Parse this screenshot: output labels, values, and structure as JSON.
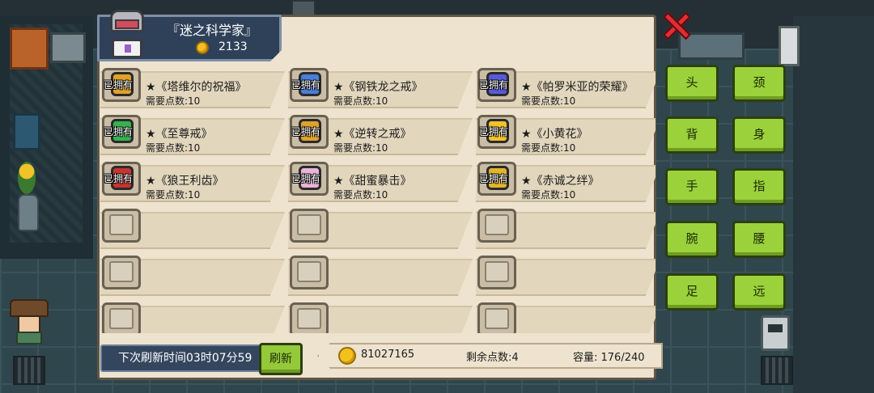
{
  "character": {
    "name": "『迷之科学家』",
    "coins": "2133"
  },
  "close_icon": "close-icon",
  "equipment_slots": {
    "head": "头",
    "neck": "颈",
    "back": "背",
    "body": "身",
    "hand": "手",
    "finger": "指",
    "wrist": "腕",
    "waist": "腰",
    "foot": "足",
    "ranged": "远"
  },
  "items": [
    {
      "owned": "已拥有",
      "name": "★《塔维尔的祝福》",
      "cost": "需要点数:10",
      "color": "#e0a22a"
    },
    {
      "owned": "已拥有",
      "name": "★《钢铁龙之戒》",
      "cost": "需要点数:10",
      "color": "#4c7ed8"
    },
    {
      "owned": "已拥有",
      "name": "★《帕罗米亚的荣耀》",
      "cost": "需要点数:10",
      "color": "#5a5ad8"
    },
    {
      "owned": "已拥有",
      "name": "★《至尊戒》",
      "cost": "需要点数:10",
      "color": "#36b34d"
    },
    {
      "owned": "已拥有",
      "name": "★《逆转之戒》",
      "cost": "需要点数:10",
      "color": "#e0a22a"
    },
    {
      "owned": "已拥有",
      "name": "★《小黄花》",
      "cost": "需要点数:10",
      "color": "#f2c22b"
    },
    {
      "owned": "已拥有",
      "name": "★《狼王利齿》",
      "cost": "需要点数:10",
      "color": "#c8342f"
    },
    {
      "owned": "已拥有",
      "name": "★《甜蜜暴击》",
      "cost": "需要点数:10",
      "color": "#e8b4d8"
    },
    {
      "owned": "已拥有",
      "name": "★《赤诚之绊》",
      "cost": "需要点数:10",
      "color": "#e2b52a"
    }
  ],
  "empty_rows": 3,
  "bottom": {
    "refresh_time": "下次刷新时间03时07分59",
    "refresh_button": "刷新",
    "gold": "81027165",
    "remaining_points": "剩余点数:4",
    "capacity": "容量:  176/240"
  }
}
